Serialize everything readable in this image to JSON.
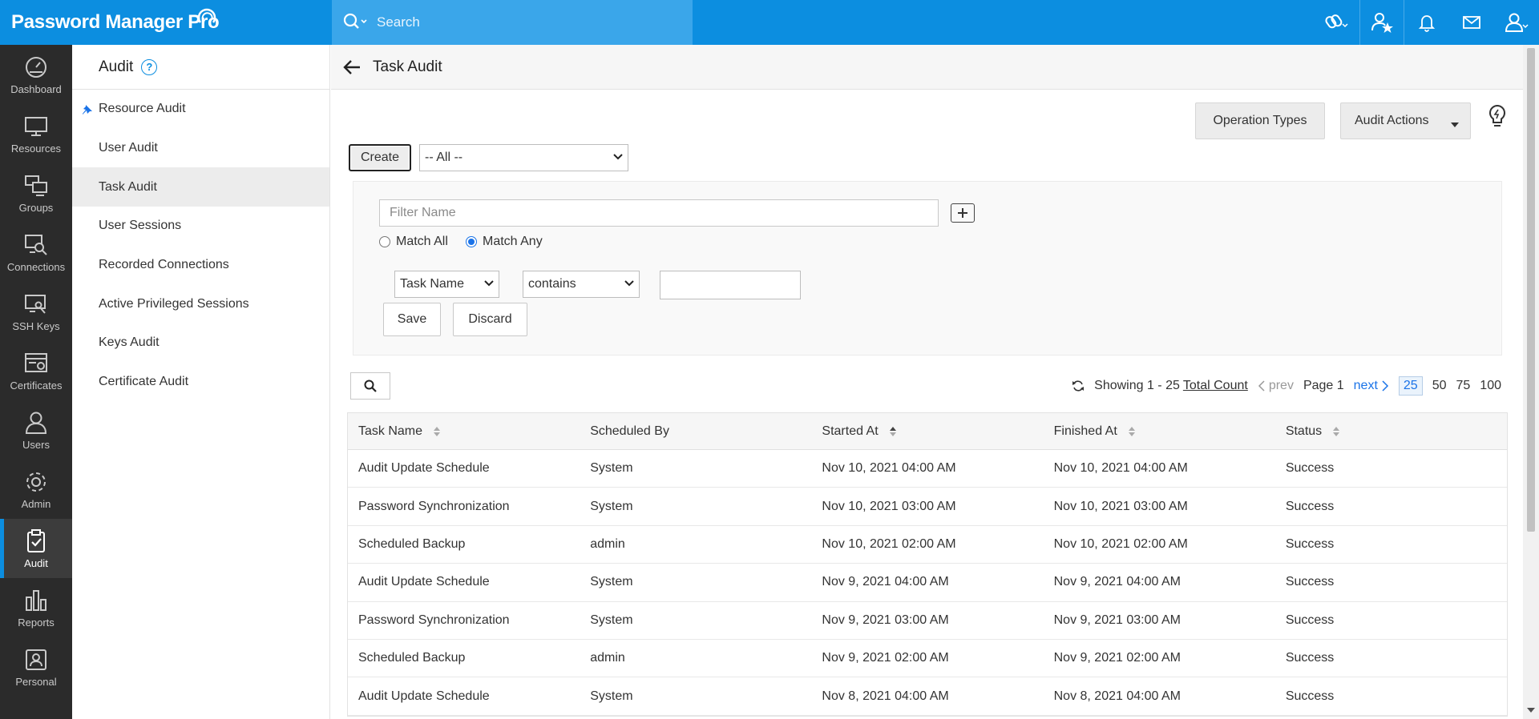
{
  "app": {
    "title": "Password Manager Pro"
  },
  "search": {
    "placeholder": "Search"
  },
  "nav": [
    {
      "label": "Dashboard",
      "icon": "dashboard-icon"
    },
    {
      "label": "Resources",
      "icon": "monitor-icon"
    },
    {
      "label": "Groups",
      "icon": "groups-icon"
    },
    {
      "label": "Connections",
      "icon": "connections-icon"
    },
    {
      "label": "SSH Keys",
      "icon": "ssh-keys-icon"
    },
    {
      "label": "Certificates",
      "icon": "certificates-icon"
    },
    {
      "label": "Users",
      "icon": "user-icon"
    },
    {
      "label": "Admin",
      "icon": "gear-icon"
    },
    {
      "label": "Audit",
      "icon": "clipboard-check-icon",
      "active": true
    },
    {
      "label": "Reports",
      "icon": "bar-chart-icon"
    },
    {
      "label": "Personal",
      "icon": "personal-icon"
    }
  ],
  "subnav": {
    "title": "Audit",
    "help": "?",
    "items": [
      "Resource Audit",
      "User Audit",
      "Task Audit",
      "User Sessions",
      "Recorded Connections",
      "Active Privileged Sessions",
      "Keys Audit",
      "Certificate Audit"
    ],
    "active_index": 2
  },
  "main": {
    "title": "Task Audit",
    "operation_types": "Operation Types",
    "audit_actions": "Audit Actions",
    "create": "Create",
    "filter_select": "-- All --",
    "filter": {
      "name_placeholder": "Filter Name",
      "match_all": "Match All",
      "match_any": "Match Any",
      "field": "Task Name",
      "operator": "contains",
      "save": "Save",
      "discard": "Discard"
    },
    "pager": {
      "showing": "Showing 1 - 25",
      "total": "Total Count",
      "prev": "prev",
      "page": "Page 1",
      "next": "next",
      "sizes": [
        "25",
        "50",
        "75",
        "100"
      ]
    },
    "columns": [
      "Task Name",
      "Scheduled By",
      "Started At",
      "Finished At",
      "Status"
    ],
    "rows": [
      [
        "Audit Update Schedule",
        "System",
        "Nov 10, 2021 04:00 AM",
        "Nov 10, 2021 04:00 AM",
        "Success"
      ],
      [
        "Password Synchronization",
        "System",
        "Nov 10, 2021 03:00 AM",
        "Nov 10, 2021 03:00 AM",
        "Success"
      ],
      [
        "Scheduled Backup",
        "admin",
        "Nov 10, 2021 02:00 AM",
        "Nov 10, 2021 02:00 AM",
        "Success"
      ],
      [
        "Audit Update Schedule",
        "System",
        "Nov 9, 2021 04:00 AM",
        "Nov 9, 2021 04:00 AM",
        "Success"
      ],
      [
        "Password Synchronization",
        "System",
        "Nov 9, 2021 03:00 AM",
        "Nov 9, 2021 03:00 AM",
        "Success"
      ],
      [
        "Scheduled Backup",
        "admin",
        "Nov 9, 2021 02:00 AM",
        "Nov 9, 2021 02:00 AM",
        "Success"
      ],
      [
        "Audit Update Schedule",
        "System",
        "Nov 8, 2021 04:00 AM",
        "Nov 8, 2021 04:00 AM",
        "Success"
      ]
    ]
  },
  "colors": {
    "brand": "#0c8ee0",
    "nav_bg": "#2b2b2b",
    "link": "#1a73e8"
  }
}
